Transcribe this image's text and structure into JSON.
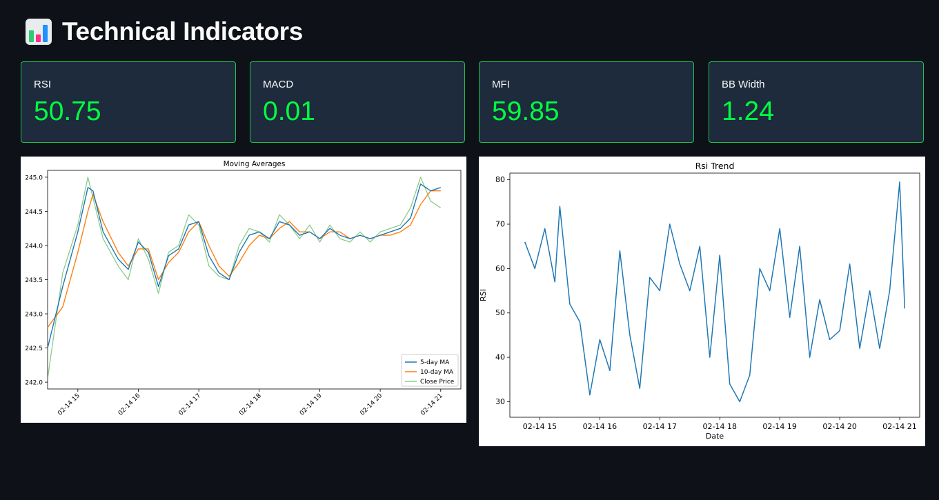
{
  "header": {
    "title": "Technical Indicators",
    "icon": "bar-chart-icon"
  },
  "metrics": [
    {
      "label": "RSI",
      "value": "50.75"
    },
    {
      "label": "MACD",
      "value": "0.01"
    },
    {
      "label": "MFI",
      "value": "59.85"
    },
    {
      "label": "BB Width",
      "value": "1.24"
    }
  ],
  "colors": {
    "background": "#0e1117",
    "card": "#1e2b3c",
    "border": "#21c354",
    "value": "#00ff41",
    "ma5": "#1f77b4",
    "ma10": "#ff7f0e",
    "close": "#2ca02c"
  },
  "chart_data": [
    {
      "type": "line",
      "title": "Moving Averages",
      "xlabel": "",
      "ylabel": "",
      "xticks": [
        "02-14 15",
        "02-14 16",
        "02-14 17",
        "02-14 18",
        "02-14 19",
        "02-14 20",
        "02-14 21"
      ],
      "xlim": [
        "02-14 14:30",
        "02-14 21:20"
      ],
      "ylim": [
        241.9,
        245.1
      ],
      "yticks": [
        "242.0",
        "242.5",
        "243.0",
        "243.5",
        "244.0",
        "244.5",
        "245.0"
      ],
      "legend_position": "bottom-right",
      "series": [
        {
          "name": "5-day MA",
          "x": [
            "02-14 14:30",
            "02-14 14:45",
            "02-14 15:00",
            "02-14 15:10",
            "02-14 15:15",
            "02-14 15:25",
            "02-14 15:40",
            "02-14 15:50",
            "02-14 16:00",
            "02-14 16:10",
            "02-14 16:20",
            "02-14 16:30",
            "02-14 16:40",
            "02-14 16:50",
            "02-14 17:00",
            "02-14 17:10",
            "02-14 17:20",
            "02-14 17:30",
            "02-14 17:40",
            "02-14 17:50",
            "02-14 18:00",
            "02-14 18:10",
            "02-14 18:20",
            "02-14 18:30",
            "02-14 18:40",
            "02-14 18:50",
            "02-14 19:00",
            "02-14 19:10",
            "02-14 19:20",
            "02-14 19:30",
            "02-14 19:40",
            "02-14 19:50",
            "02-14 20:00",
            "02-14 20:10",
            "02-14 20:20",
            "02-14 20:30",
            "02-14 20:40",
            "02-14 20:50",
            "02-14 21:00"
          ],
          "values": [
            242.5,
            243.4,
            244.2,
            244.85,
            244.8,
            244.2,
            243.8,
            243.65,
            244.05,
            243.9,
            243.4,
            243.85,
            243.95,
            244.3,
            244.35,
            243.85,
            243.6,
            243.5,
            243.9,
            244.15,
            244.2,
            244.1,
            244.35,
            244.3,
            244.15,
            244.2,
            244.1,
            244.25,
            244.15,
            244.1,
            244.15,
            244.1,
            244.15,
            244.2,
            244.25,
            244.4,
            244.9,
            244.8,
            244.85
          ]
        },
        {
          "name": "10-day MA",
          "x": [
            "02-14 14:30",
            "02-14 14:45",
            "02-14 15:00",
            "02-14 15:10",
            "02-14 15:15",
            "02-14 15:25",
            "02-14 15:40",
            "02-14 15:50",
            "02-14 16:00",
            "02-14 16:10",
            "02-14 16:20",
            "02-14 16:30",
            "02-14 16:40",
            "02-14 16:50",
            "02-14 17:00",
            "02-14 17:10",
            "02-14 17:20",
            "02-14 17:30",
            "02-14 17:40",
            "02-14 17:50",
            "02-14 18:00",
            "02-14 18:10",
            "02-14 18:20",
            "02-14 18:30",
            "02-14 18:40",
            "02-14 18:50",
            "02-14 19:00",
            "02-14 19:10",
            "02-14 19:20",
            "02-14 19:30",
            "02-14 19:40",
            "02-14 19:50",
            "02-14 20:00",
            "02-14 20:10",
            "02-14 20:20",
            "02-14 20:30",
            "02-14 20:40",
            "02-14 20:50",
            "02-14 21:00"
          ],
          "values": [
            242.8,
            243.1,
            243.9,
            244.5,
            244.75,
            244.35,
            243.9,
            243.7,
            243.95,
            243.95,
            243.5,
            243.75,
            243.9,
            244.2,
            244.35,
            244.0,
            243.7,
            243.55,
            243.75,
            244.0,
            244.15,
            244.1,
            244.25,
            244.35,
            244.2,
            244.2,
            244.1,
            244.2,
            244.2,
            244.1,
            244.15,
            244.1,
            244.15,
            244.15,
            244.2,
            244.3,
            244.6,
            244.8,
            244.8
          ]
        },
        {
          "name": "Close Price",
          "x": [
            "02-14 14:30",
            "02-14 14:45",
            "02-14 15:00",
            "02-14 15:10",
            "02-14 15:15",
            "02-14 15:25",
            "02-14 15:40",
            "02-14 15:50",
            "02-14 16:00",
            "02-14 16:10",
            "02-14 16:20",
            "02-14 16:30",
            "02-14 16:40",
            "02-14 16:50",
            "02-14 17:00",
            "02-14 17:10",
            "02-14 17:20",
            "02-14 17:30",
            "02-14 17:40",
            "02-14 17:50",
            "02-14 18:00",
            "02-14 18:10",
            "02-14 18:20",
            "02-14 18:30",
            "02-14 18:40",
            "02-14 18:50",
            "02-14 19:00",
            "02-14 19:10",
            "02-14 19:20",
            "02-14 19:30",
            "02-14 19:40",
            "02-14 19:50",
            "02-14 20:00",
            "02-14 20:10",
            "02-14 20:20",
            "02-14 20:30",
            "02-14 20:40",
            "02-14 20:50",
            "02-14 21:00"
          ],
          "values": [
            242.05,
            243.6,
            244.3,
            245.0,
            244.7,
            244.1,
            243.7,
            243.5,
            244.1,
            243.8,
            243.3,
            243.9,
            244.0,
            244.45,
            244.3,
            243.7,
            243.55,
            243.5,
            244.0,
            244.25,
            244.2,
            244.05,
            244.45,
            244.3,
            244.1,
            244.3,
            244.05,
            244.3,
            244.1,
            244.05,
            244.2,
            244.05,
            244.2,
            244.25,
            244.3,
            244.55,
            245.0,
            244.65,
            244.55
          ]
        }
      ]
    },
    {
      "type": "line",
      "title": "Rsi Trend",
      "xlabel": "Date",
      "ylabel": "RSI",
      "xticks": [
        "02-14 15",
        "02-14 16",
        "02-14 17",
        "02-14 18",
        "02-14 19",
        "02-14 20",
        "02-14 21"
      ],
      "xlim": [
        "02-14 14:30",
        "02-14 21:20"
      ],
      "ylim": [
        26.5,
        81.5
      ],
      "yticks": [
        "30",
        "40",
        "50",
        "60",
        "70",
        "80"
      ],
      "series": [
        {
          "name": "",
          "x": [
            "02-14 14:45",
            "02-14 14:55",
            "02-14 15:05",
            "02-14 15:15",
            "02-14 15:20",
            "02-14 15:30",
            "02-14 15:40",
            "02-14 15:50",
            "02-14 16:00",
            "02-14 16:10",
            "02-14 16:20",
            "02-14 16:30",
            "02-14 16:40",
            "02-14 16:50",
            "02-14 17:00",
            "02-14 17:10",
            "02-14 17:20",
            "02-14 17:30",
            "02-14 17:40",
            "02-14 17:50",
            "02-14 18:00",
            "02-14 18:10",
            "02-14 18:20",
            "02-14 18:30",
            "02-14 18:40",
            "02-14 18:50",
            "02-14 19:00",
            "02-14 19:10",
            "02-14 19:20",
            "02-14 19:30",
            "02-14 19:40",
            "02-14 19:50",
            "02-14 20:00",
            "02-14 20:10",
            "02-14 20:20",
            "02-14 20:30",
            "02-14 20:40",
            "02-14 20:50",
            "02-14 21:00",
            "02-14 21:05"
          ],
          "values": [
            66,
            60,
            69,
            57,
            74,
            52,
            48,
            31.5,
            44,
            37,
            64,
            45,
            33,
            58,
            55,
            70,
            61,
            55,
            65,
            40,
            63,
            34,
            30,
            36,
            60,
            55,
            69,
            49,
            65,
            40,
            53,
            44,
            46,
            61,
            42,
            55,
            42,
            55,
            79.5,
            51
          ]
        }
      ]
    }
  ]
}
